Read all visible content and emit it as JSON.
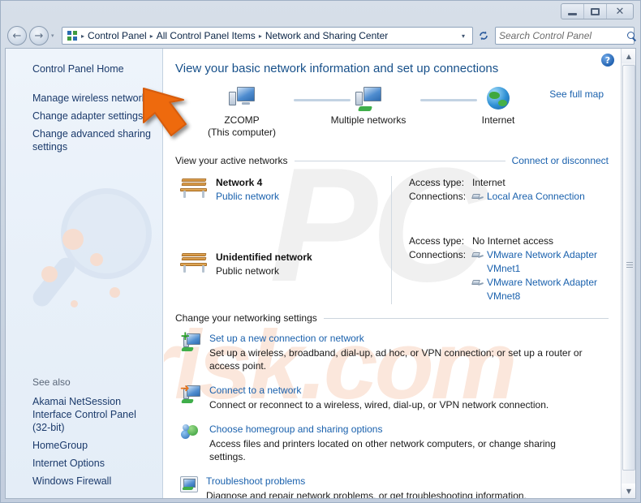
{
  "window": {
    "buttons": {
      "minimize": "Minimize",
      "maximize": "Maximize",
      "close": "Close"
    }
  },
  "nav": {
    "back": "←",
    "forward": "→",
    "recent_pages": "▾",
    "breadcrumb": [
      "Control Panel",
      "All Control Panel Items",
      "Network and Sharing Center"
    ],
    "separator": "▸",
    "address_dropdown": "▾",
    "refresh": "↻",
    "search_placeholder": "Search Control Panel",
    "search_value": ""
  },
  "sidebar": {
    "items": [
      {
        "label": "Control Panel Home"
      },
      {
        "label": "Manage wireless networks"
      },
      {
        "label": "Change adapter settings"
      },
      {
        "label": "Change advanced sharing settings"
      }
    ],
    "see_also_title": "See also",
    "see_also": [
      {
        "label": "Akamai NetSession Interface Control Panel (32-bit)"
      },
      {
        "label": "HomeGroup"
      },
      {
        "label": "Internet Options"
      },
      {
        "label": "Windows Firewall"
      }
    ]
  },
  "main": {
    "help": "?",
    "page_title": "View your basic network information and set up connections",
    "map": {
      "see_full_map": "See full map",
      "nodes": [
        {
          "name": "ZCOMP",
          "sub": "(This computer)",
          "icon": "computer-icon"
        },
        {
          "name": "Multiple networks",
          "sub": "",
          "icon": "network-icon"
        },
        {
          "name": "Internet",
          "sub": "",
          "icon": "globe-icon"
        }
      ]
    },
    "active_networks": {
      "heading": "View your active networks",
      "action": "Connect or disconnect",
      "networks": [
        {
          "name": "Network  4",
          "type": "Public network",
          "access_label": "Access type:",
          "access_value": "Internet",
          "connections_label": "Connections:",
          "connections": [
            "Local Area Connection"
          ]
        },
        {
          "name": "Unidentified network",
          "type": "Public network",
          "access_label": "Access type:",
          "access_value": "No Internet access",
          "connections_label": "Connections:",
          "connections": [
            "VMware Network Adapter VMnet1",
            "VMware Network Adapter VMnet8"
          ]
        }
      ]
    },
    "settings": {
      "heading": "Change your networking settings",
      "actions": [
        {
          "title": "Set up a new connection or network",
          "desc": "Set up a wireless, broadband, dial-up, ad hoc, or VPN connection; or set up a router or access point.",
          "icon": "new-connection-icon"
        },
        {
          "title": "Connect to a network",
          "desc": "Connect or reconnect to a wireless, wired, dial-up, or VPN network connection.",
          "icon": "connect-network-icon"
        },
        {
          "title": "Choose homegroup and sharing options",
          "desc": "Access files and printers located on other network computers, or change sharing settings.",
          "icon": "homegroup-icon"
        },
        {
          "title": "Troubleshoot problems",
          "desc": "Diagnose and repair network problems, or get troubleshooting information.",
          "icon": "troubleshoot-icon"
        }
      ]
    }
  },
  "scrollbar": {
    "up": "▲",
    "down": "▼"
  },
  "colors": {
    "link": "#1a61ad",
    "title": "#17508a",
    "frame": "#c3cede",
    "sidebar": "#e8f0f9",
    "highlight_arrow": "#ee6a10"
  }
}
